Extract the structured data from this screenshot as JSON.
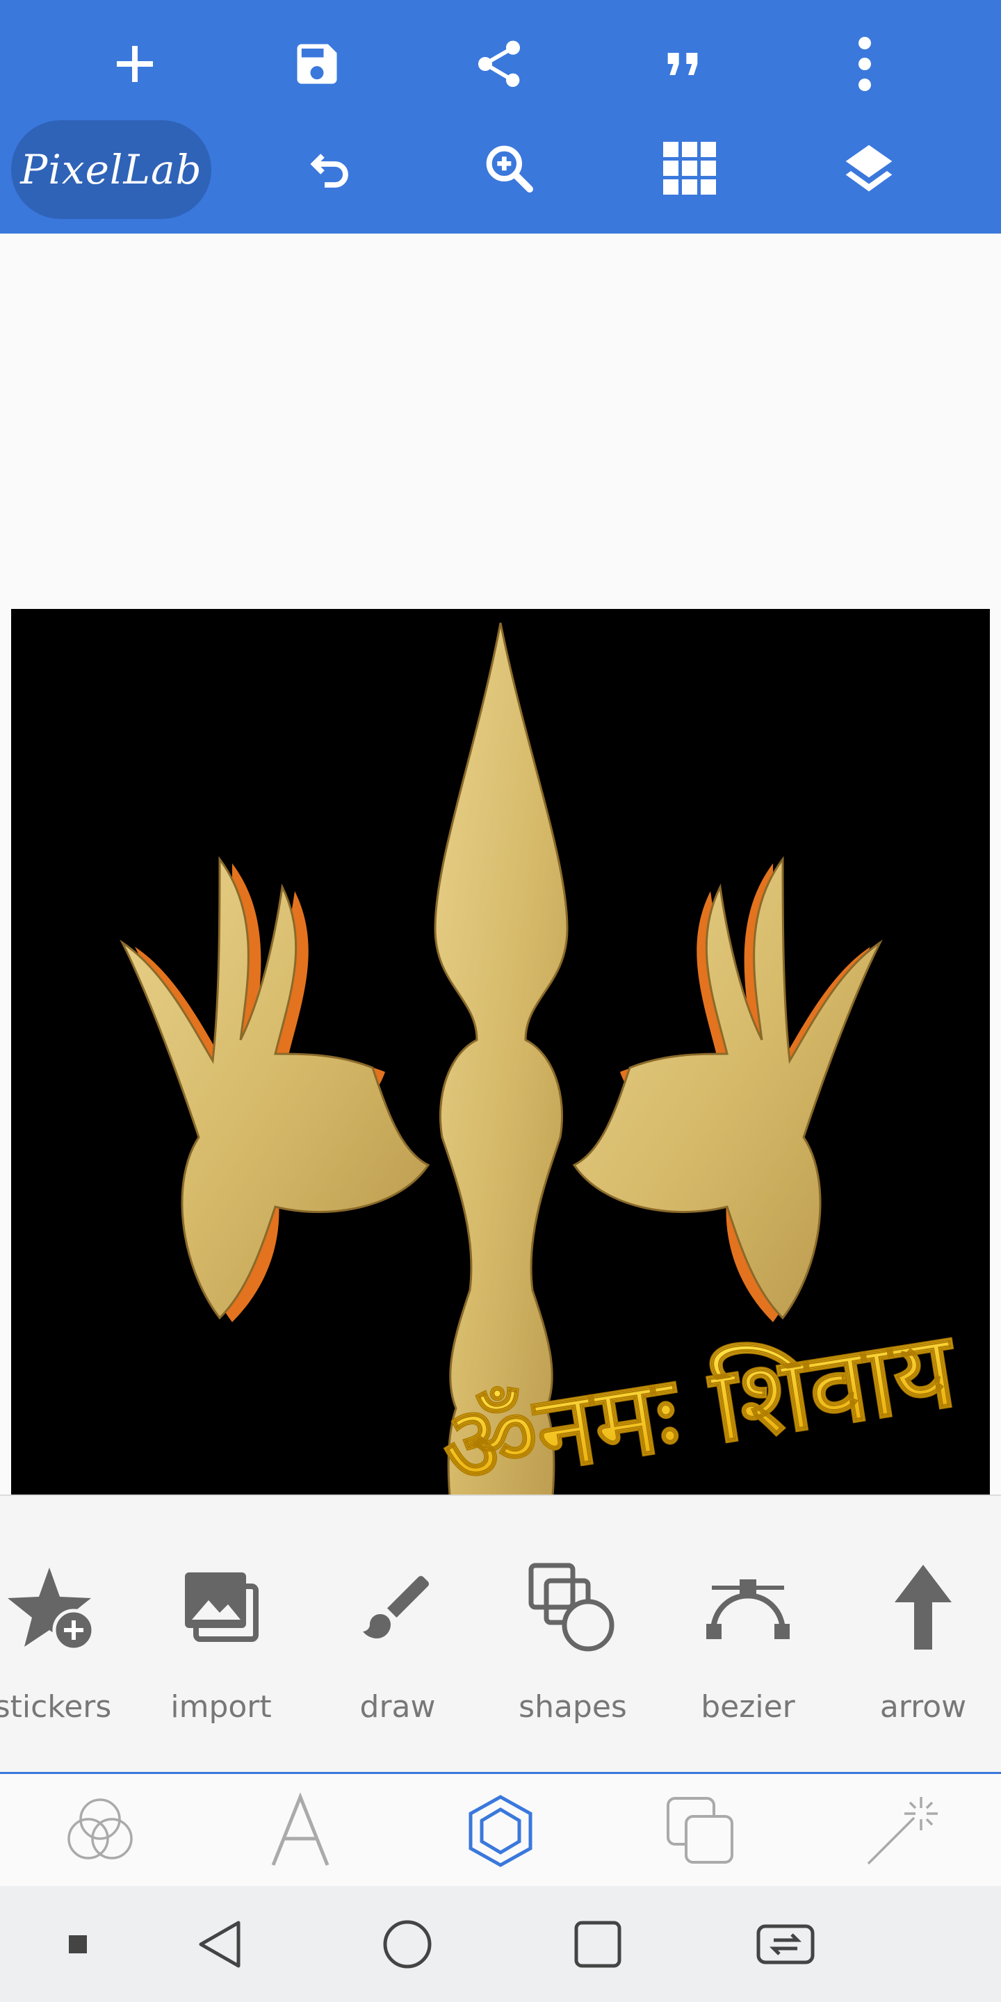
{
  "app": {
    "logo_text": "PixelLab"
  },
  "toolbar_top": [
    {
      "icon": "plus-icon"
    },
    {
      "icon": "save-icon"
    },
    {
      "icon": "share-icon"
    },
    {
      "icon": "quote-icon"
    },
    {
      "icon": "more-vert-icon"
    }
  ],
  "toolbar_second": [
    {
      "icon": "undo-icon"
    },
    {
      "icon": "zoom-in-icon"
    },
    {
      "icon": "grid-icon"
    },
    {
      "icon": "layers-icon"
    }
  ],
  "canvas": {
    "background": "#000000",
    "text_layer": "ॐनमः शिवाय"
  },
  "tools": [
    {
      "label": "stickers",
      "icon": "sticker-add-icon"
    },
    {
      "label": "import",
      "icon": "image-import-icon"
    },
    {
      "label": "draw",
      "icon": "brush-icon"
    },
    {
      "label": "shapes",
      "icon": "shapes-icon"
    },
    {
      "label": "bezier",
      "icon": "bezier-icon"
    },
    {
      "label": "arrow",
      "icon": "arrow-up-icon"
    }
  ],
  "mode_tabs": [
    {
      "icon": "blend-circles-icon",
      "active": false
    },
    {
      "icon": "text-a-icon",
      "active": false
    },
    {
      "icon": "hexagon-icon",
      "active": true
    },
    {
      "icon": "duplicate-icon",
      "active": false
    },
    {
      "icon": "magic-wand-icon",
      "active": false
    }
  ],
  "colors": {
    "primary": "#3a78dc",
    "active_tab": "#3a78dc",
    "text_gold": "#f2c21a",
    "trident_gold": "#d9bf73"
  }
}
